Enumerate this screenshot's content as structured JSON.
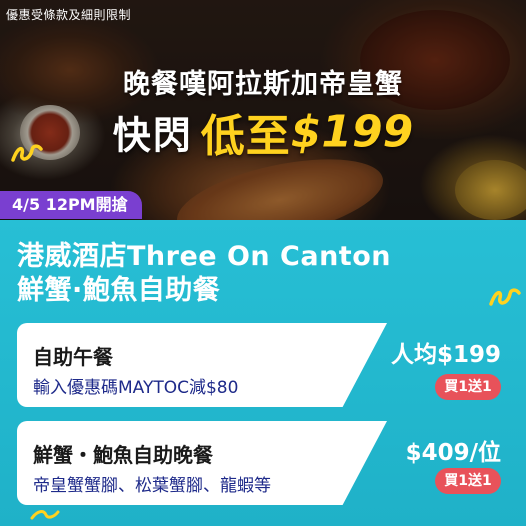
{
  "notice": "優惠受條款及細則限制",
  "headline": {
    "line1": "晚餐嘆阿拉斯加帝皇蟹",
    "line2_prefix": "快閃",
    "line2_highlight": "低至",
    "line2_price": "$199"
  },
  "launch_badge": "4/5 12PM開搶",
  "hotel": {
    "name_line1": "港威酒店Three On Canton",
    "name_line2": "鮮蟹·鮑魚自助餐"
  },
  "offers": [
    {
      "name": "自助午餐",
      "description": "輸入優惠碼MAYTOC減$80",
      "price": "人均$199",
      "badge": "買1送1"
    },
    {
      "name": "鮮蟹・鮑魚自助晚餐",
      "description": "帝皇蟹蟹腳、松葉蟹腳、龍蝦等",
      "price": "$409/位",
      "badge": "買1送1"
    }
  ],
  "colors": {
    "panel": "#22b9cf",
    "badge_purple": "#7a3fd0",
    "price_yellow": "#ffd21f",
    "pill_red": "#e8525a",
    "description_blue": "#1e2a8a"
  }
}
